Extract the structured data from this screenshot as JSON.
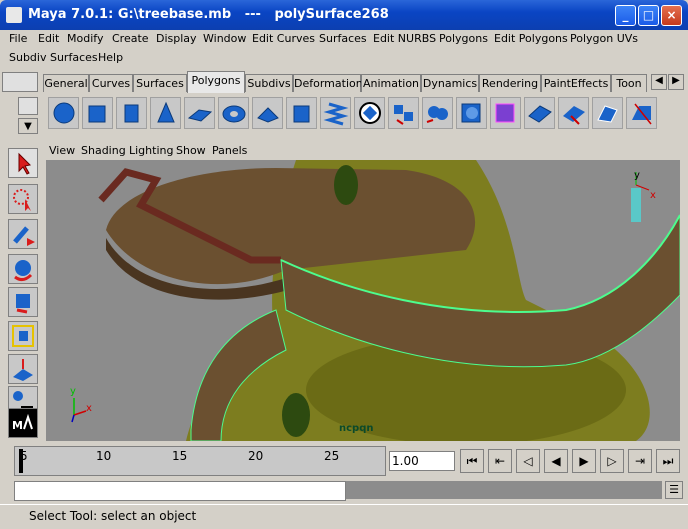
{
  "window": {
    "title": "Maya 7.0.1: G:\\treebase.mb   ---   polySurface268"
  },
  "menubar": [
    "File",
    "Edit",
    "Modify",
    "Create",
    "Display",
    "Window",
    "Edit Curves",
    "Surfaces",
    "Edit NURBS",
    "Polygons",
    "Edit Polygons",
    "Polygon UVs",
    "Subdiv Surfaces",
    "Help"
  ],
  "shelf": {
    "tabs": [
      "General",
      "Curves",
      "Surfaces",
      "Polygons",
      "Subdivs",
      "Deformation",
      "Animation",
      "Dynamics",
      "Rendering",
      "PaintEffects",
      "Toon"
    ],
    "active": "Polygons"
  },
  "panel_menu": [
    "View",
    "Shading",
    "Lighting",
    "Show",
    "Panels"
  ],
  "viewport": {
    "axis_y": "y",
    "axis_x": "x",
    "hud_label": "ncpqn",
    "gizmo_y": "y",
    "gizmo_x": "x"
  },
  "timeline": {
    "ticks": [
      "5",
      "10",
      "15",
      "20",
      "25"
    ],
    "current_time": "1.00"
  },
  "status": {
    "help_text": "Select Tool: select an object"
  }
}
